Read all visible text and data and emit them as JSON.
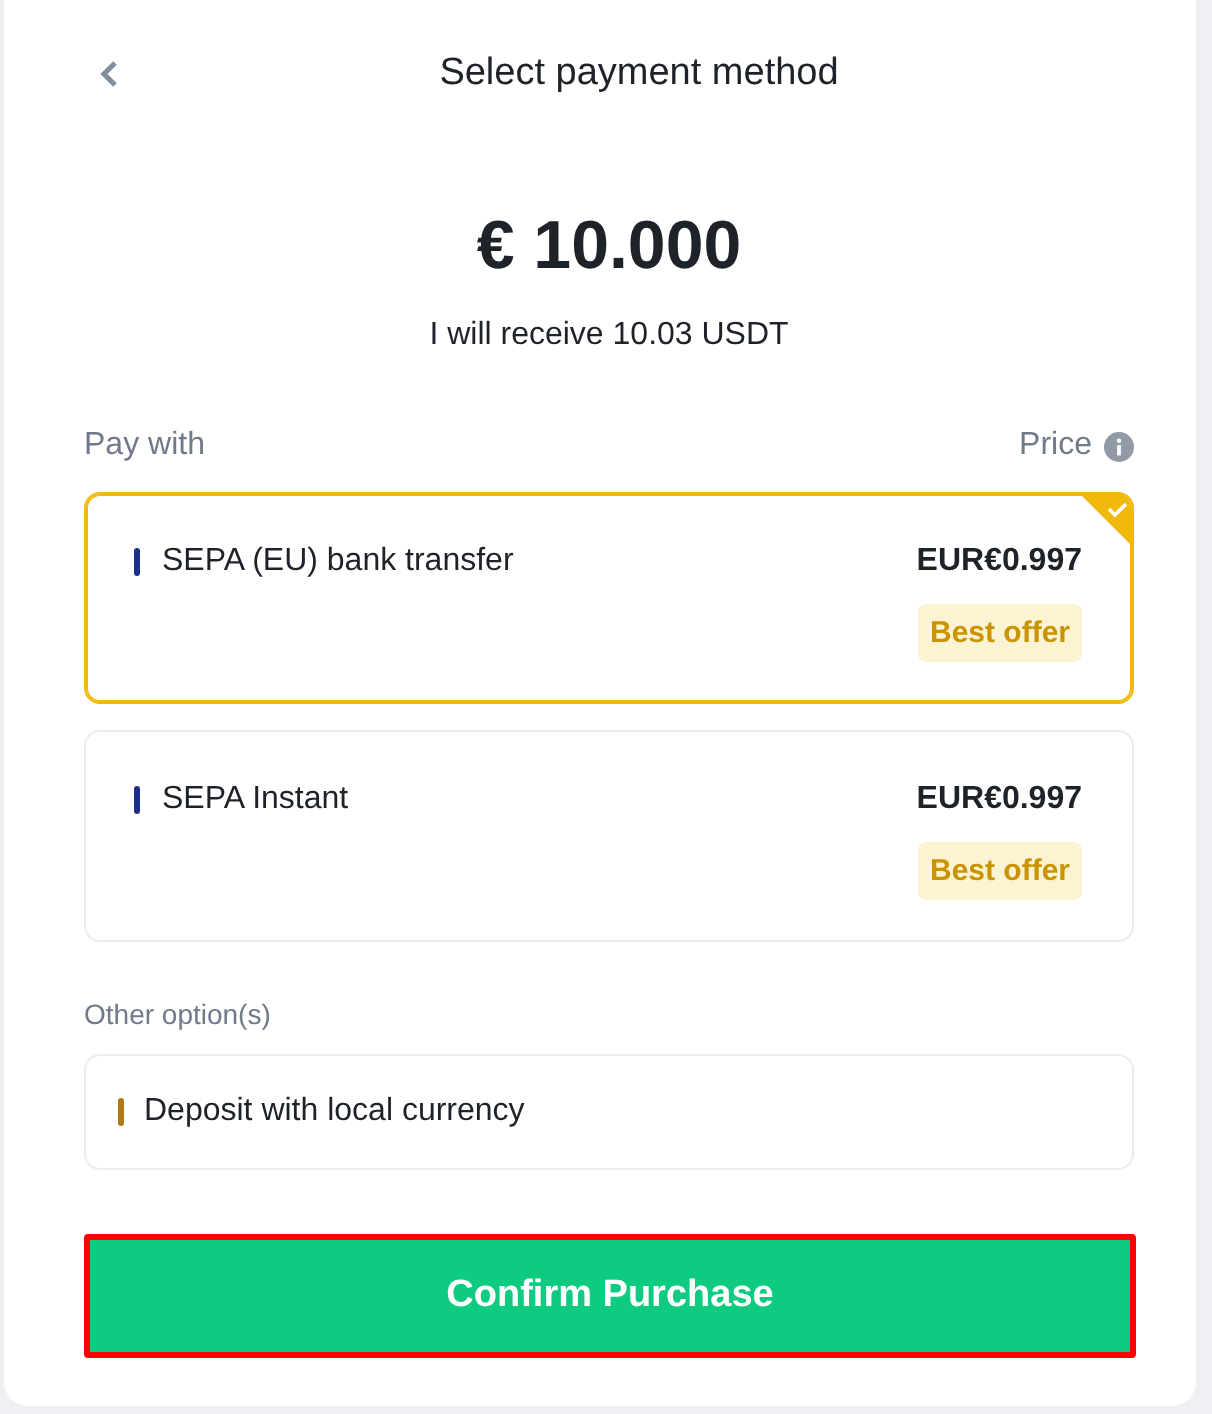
{
  "header": {
    "title": "Select payment method"
  },
  "amount": "€ 10.000",
  "receive_note": "I will receive 10.03 USDT",
  "list_header": {
    "label": "Pay with",
    "price_label": "Price"
  },
  "methods": [
    {
      "name": "SEPA (EU) bank transfer",
      "price": "EUR€0.997",
      "badge": "Best offer",
      "color": "#1b2d8f",
      "selected": true
    },
    {
      "name": "SEPA Instant",
      "price": "EUR€0.997",
      "badge": "Best offer",
      "color": "#1b2d8f",
      "selected": false
    }
  ],
  "other_options": {
    "label": "Other option(s)",
    "items": [
      {
        "name": "Deposit with local currency",
        "color": "#b07a10"
      }
    ]
  },
  "confirm_button": {
    "label": "Confirm Purchase",
    "highlighted": true
  }
}
